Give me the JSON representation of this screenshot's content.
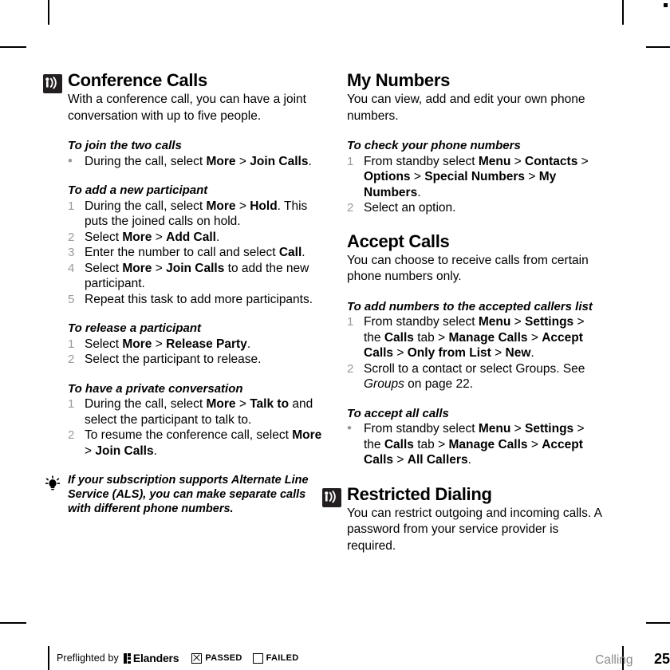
{
  "document": {
    "section_footer": "Calling",
    "page_number": "25"
  },
  "left_column": {
    "section": {
      "icon": "broadcast-signal-icon",
      "title": "Conference Calls",
      "intro": "With a conference call, you can have a joint conversation with up to five people."
    },
    "task1": {
      "heading": "To join the two calls",
      "items": [
        {
          "marker": "•",
          "html": "During the call, select <b>More</b> <span class=\"gt\">&gt;</span> <b>Join Calls</b>."
        }
      ]
    },
    "task2": {
      "heading": "To add a new participant",
      "items": [
        {
          "marker": "1",
          "html": "During the call, select <b>More</b> <span class=\"gt\">&gt;</span> <b>Hold</b>. This puts the joined calls on hold."
        },
        {
          "marker": "2",
          "html": "Select <b>More</b> <span class=\"gt\">&gt;</span> <b>Add Call</b>."
        },
        {
          "marker": "3",
          "html": "Enter the number to call and select <b>Call</b>."
        },
        {
          "marker": "4",
          "html": "Select <b>More</b> <span class=\"gt\">&gt;</span> <b>Join Calls</b> to add the new participant."
        },
        {
          "marker": "5",
          "html": "Repeat this task to add more participants."
        }
      ]
    },
    "task3": {
      "heading": "To release a participant",
      "items": [
        {
          "marker": "1",
          "html": "Select <b>More</b> <span class=\"gt\">&gt;</span> <b>Release Party</b>."
        },
        {
          "marker": "2",
          "html": "Select the participant to release."
        }
      ]
    },
    "task4": {
      "heading": "To have a private conversation",
      "items": [
        {
          "marker": "1",
          "html": "During the call, select <b>More</b> <span class=\"gt\">&gt;</span> <b>Talk to</b> and select the participant to talk to."
        },
        {
          "marker": "2",
          "html": "To resume the conference call, select <b>More</b> <span class=\"gt\">&gt;</span> <b>Join Calls</b>."
        }
      ]
    },
    "tip": {
      "icon": "lightbulb-tip-icon",
      "text": "If your subscription supports Alternate Line Service (ALS), you can make separate calls with different phone numbers."
    }
  },
  "right_column": {
    "section1": {
      "title": "My Numbers",
      "intro": "You can view, add and edit your own phone numbers."
    },
    "task1": {
      "heading": "To check your phone numbers",
      "items": [
        {
          "marker": "1",
          "html": "From standby select <b>Menu</b> <span class=\"gt\">&gt;</span> <b>Contacts</b> <span class=\"gt\">&gt;</span> <b>Options</b> <span class=\"gt\">&gt;</span> <b>Special Numbers</b> <span class=\"gt\">&gt;</span> <b>My Numbers</b>."
        },
        {
          "marker": "2",
          "html": "Select an option."
        }
      ]
    },
    "section2": {
      "title": "Accept Calls",
      "intro": "You can choose to receive calls from certain phone numbers only."
    },
    "task2": {
      "heading": "To add numbers to the accepted callers list",
      "items": [
        {
          "marker": "1",
          "html": "From standby select <b>Menu</b> <span class=\"gt\">&gt;</span> <b>Settings</b> <span class=\"gt\">&gt;</span> the <b>Calls</b> tab <span class=\"gt\">&gt;</span> <b>Manage Calls</b> <span class=\"gt\">&gt;</span> <b>Accept Calls</b> <span class=\"gt\">&gt;</span> <b>Only from List</b> <span class=\"gt\">&gt;</span> <b>New</b>."
        },
        {
          "marker": "2",
          "html": "Scroll to a contact or select Groups. See <i class=\"em\">Groups</i> on page 22."
        }
      ]
    },
    "task3": {
      "heading": "To accept all calls",
      "items": [
        {
          "marker": "•",
          "html": "From standby select <b>Menu</b> <span class=\"gt\">&gt;</span> <b>Settings</b> <span class=\"gt\">&gt;</span> the <b>Calls</b> tab <span class=\"gt\">&gt;</span> <b>Manage Calls</b> <span class=\"gt\">&gt;</span> <b>Accept Calls</b> <span class=\"gt\">&gt;</span> <b>All Callers</b>."
        }
      ]
    },
    "section3": {
      "icon": "broadcast-signal-icon",
      "title": "Restricted Dialing",
      "intro": "You can restrict outgoing and incoming calls. A password from your service provider is required."
    }
  },
  "preflight": {
    "label": "Preflighted by",
    "brand": "Elanders",
    "passed_label": "PASSED",
    "passed_checked": true,
    "failed_label": "FAILED",
    "failed_checked": false
  }
}
